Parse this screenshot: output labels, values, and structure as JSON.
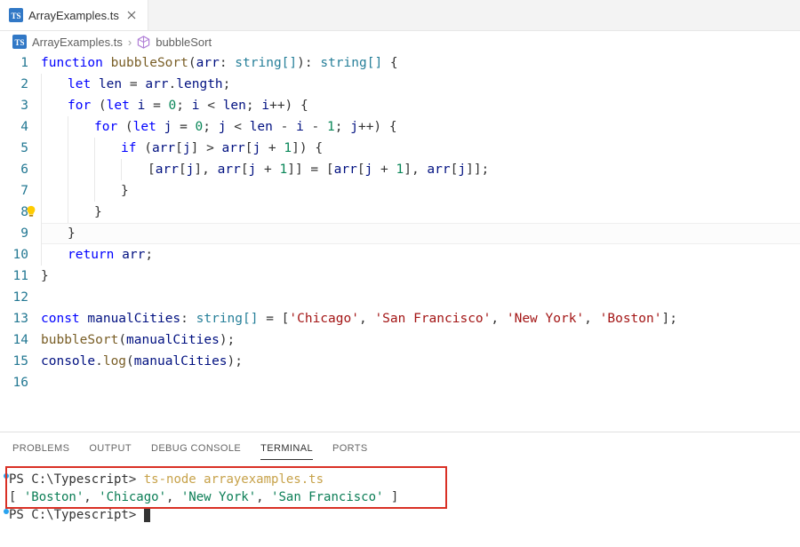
{
  "tab": {
    "icon": "TS",
    "filename": "ArrayExamples.ts"
  },
  "breadcrumb": {
    "file_icon": "TS",
    "file": "ArrayExamples.ts",
    "symbol": "bubbleSort"
  },
  "code": {
    "line_numbers": [
      "1",
      "2",
      "3",
      "4",
      "5",
      "6",
      "7",
      "8",
      "9",
      "10",
      "11",
      "12",
      "13",
      "14",
      "15",
      "16"
    ],
    "kw_function": "function",
    "fn_bubbleSort": "bubbleSort",
    "param_arr": "arr",
    "typ_string_arr": "string[]",
    "kw_let": "let",
    "var_len": "len",
    "prop_length": "length",
    "kw_for": "for",
    "var_i": "i",
    "var_j": "j",
    "num_0": "0",
    "num_1": "1",
    "kw_if": "if",
    "kw_return": "return",
    "kw_const": "const",
    "var_manualCities": "manualCities",
    "str_chicago": "'Chicago'",
    "str_sf": "'San Francisco'",
    "str_ny": "'New York'",
    "str_boston": "'Boston'",
    "fn_console": "console",
    "fn_log": "log"
  },
  "panel": {
    "tabs": {
      "problems": "PROBLEMS",
      "output": "OUTPUT",
      "debug": "DEBUG CONSOLE",
      "terminal": "TERMINAL",
      "ports": "PORTS"
    }
  },
  "terminal": {
    "prompt": "PS C:\\Typescript>",
    "command": "ts-node arrayexamples.ts",
    "out_open": "[ ",
    "out_s1": "'Boston'",
    "out_s2": "'Chicago'",
    "out_s3": "'New York'",
    "out_s4": "'San Francisco'",
    "out_close": " ]",
    "sep": ", "
  }
}
